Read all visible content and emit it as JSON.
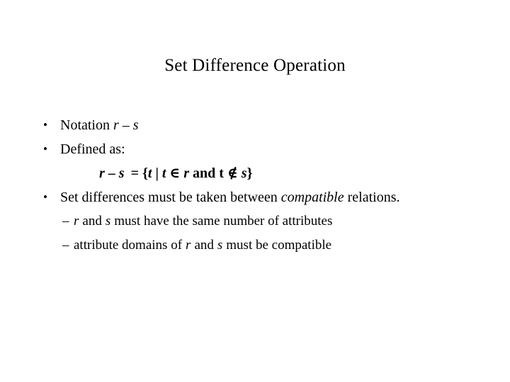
{
  "slide": {
    "title": "Set Difference Operation",
    "background_color": "#ffffff",
    "text_color": "#000000",
    "bullet_glyph": "•",
    "dash_glyph": "–",
    "items": [
      {
        "level": 1,
        "marker": "•",
        "text": "Notation r – s",
        "parts": {
          "lead": "Notation",
          "var_r": "r",
          "operator": "–",
          "var_s": "s"
        }
      },
      {
        "level": 1,
        "marker": "•",
        "text": "Defined as:",
        "parts": {
          "lead": "Defined as:"
        }
      },
      {
        "level": 0,
        "marker": "",
        "text": "r – s = {t | t ∈ r and t ∉ s}",
        "formula": {
          "var_r": "r",
          "minus": "–",
          "var_s": "s",
          "equals": "=",
          "open_brace": "{",
          "var_t1": "t",
          "bar": "|",
          "var_t2": "t",
          "element_of": "∈",
          "var_r2": "r",
          "and": "and",
          "var_t3": "t",
          "not_element_of": "∉",
          "var_s2": "s",
          "close_brace": "}"
        }
      },
      {
        "level": 1,
        "marker": "•",
        "text": "Set differences must be taken between compatible relations.",
        "parts": {
          "lead": "Set differences must be taken between",
          "emph": "compatible",
          "tail": "relations."
        }
      },
      {
        "level": 2,
        "marker": "–",
        "text": "r and s must have the same number of attributes",
        "parts": {
          "var_r": "r",
          "mid": "and",
          "var_s": "s",
          "tail": "must have the same number of attributes"
        }
      },
      {
        "level": 2,
        "marker": "–",
        "text": "attribute domains of r and s must be compatible",
        "parts": {
          "lead": "attribute domains of",
          "var_r": "r",
          "mid": "and",
          "var_s": "s",
          "tail": "must be compatible"
        }
      }
    ]
  }
}
